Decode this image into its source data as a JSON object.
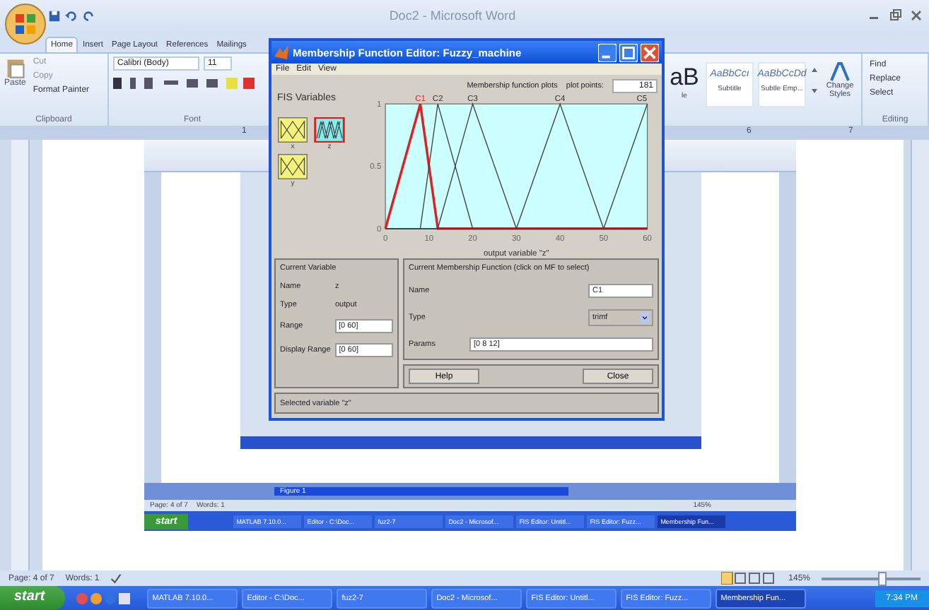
{
  "word": {
    "title": "Doc2 - Microsoft Word",
    "tabs": [
      {
        "label": "Home",
        "selected": true
      },
      {
        "label": "Insert",
        "selected": false
      },
      {
        "label": "Page Layout",
        "selected": false
      },
      {
        "label": "References",
        "selected": false
      },
      {
        "label": "Mailings",
        "selected": false
      }
    ],
    "clipboard": {
      "paste": "Paste",
      "cut": "Cut",
      "copy": "Copy",
      "format_painter": "Format Painter",
      "group": "Clipboard"
    },
    "font": {
      "name": "Calibri (Body)",
      "size": "11",
      "group": "Font"
    },
    "styles": [
      {
        "sample": "aB",
        "label": "le"
      },
      {
        "sample": "AaBbCcı",
        "label": "Subtitle"
      },
      {
        "sample": "AaBbCcDd",
        "label": "Subtle Emp..."
      }
    ],
    "change_styles": "Change Styles",
    "editing": {
      "find": "Find",
      "replace": "Replace",
      "select": "Select",
      "group": "Editing"
    },
    "ruler_marks": [
      "1",
      "6",
      "7"
    ],
    "status": {
      "page": "Page: 4 of 7",
      "words": "Words: 1",
      "zoom": "145%",
      "zoom_slider": {
        "level": 0.62
      }
    }
  },
  "embedded": {
    "figure_title": "Figure 1",
    "status_page": "Page: 4 of 7",
    "status_words": "Words: 1",
    "zoom": "145%",
    "start": "start",
    "taskbar": [
      {
        "label": "MATLAB 7.10.0...",
        "selected": false
      },
      {
        "label": "Editor - C:\\Doc...",
        "selected": false
      },
      {
        "label": "fuz2-7",
        "selected": false
      },
      {
        "label": "Doc2 - Microsof...",
        "selected": false
      },
      {
        "label": "FIS Editor: Untitl...",
        "selected": false
      },
      {
        "label": "FIS Editor: Fuzz...",
        "selected": false
      },
      {
        "label": "Membership Fun...",
        "selected": true
      }
    ]
  },
  "editor": {
    "title": "Membership Function Editor: Fuzzy_machine",
    "menu": [
      "File",
      "Edit",
      "View"
    ],
    "fis_heading": "FIS Variables",
    "variables": [
      {
        "name": "x",
        "kind": "input",
        "selected": false
      },
      {
        "name": "z",
        "kind": "output",
        "selected": true
      },
      {
        "name": "y",
        "kind": "input",
        "selected": false
      }
    ],
    "plots_label": "Membership function plots",
    "plot_points_label": "plot points:",
    "plot_points": "181",
    "chart_data": {
      "type": "line",
      "xlabel": "output variable \"z\"",
      "x": [
        0,
        8,
        12,
        20,
        30,
        40,
        50,
        60
      ],
      "series": [
        {
          "name": "C1",
          "color": "#e02020",
          "values": [
            0,
            1,
            0,
            0,
            0,
            0,
            0,
            0
          ]
        },
        {
          "name": "C2",
          "color": "#404040",
          "values": [
            0,
            0,
            1,
            0,
            0,
            0,
            0,
            0
          ]
        },
        {
          "name": "C3",
          "color": "#404040",
          "values": [
            0,
            0,
            0,
            1,
            0,
            0,
            0,
            0
          ]
        },
        {
          "name": "C4",
          "color": "#404040",
          "values": [
            0,
            0,
            0,
            0,
            0,
            1,
            0,
            0
          ]
        },
        {
          "name": "C5",
          "color": "#404040",
          "values": [
            0,
            0,
            0,
            0,
            0,
            0,
            0,
            1
          ]
        }
      ],
      "xlim": [
        0,
        60
      ],
      "ylim": [
        0,
        1
      ],
      "xticks": [
        0,
        10,
        20,
        30,
        40,
        50,
        60
      ],
      "yticks": [
        0,
        0.5,
        1
      ]
    },
    "current_variable": {
      "heading": "Current Variable",
      "name_label": "Name",
      "name": "z",
      "type_label": "Type",
      "type": "output",
      "range_label": "Range",
      "range": "[0 60]",
      "display_range_label": "Display Range",
      "display_range": "[0 60]"
    },
    "current_mf": {
      "heading": "Current Membership Function (click on MF to select)",
      "name_label": "Name",
      "name": "C1",
      "type_label": "Type",
      "type": "trimf",
      "params_label": "Params",
      "params": "[0 8 12]"
    },
    "buttons": [
      "Help",
      "Close"
    ],
    "status": "Selected variable \"z\""
  },
  "taskbar": {
    "start": "start",
    "items": [
      {
        "label": "MATLAB 7.10.0...",
        "selected": false
      },
      {
        "label": "Editor - C:\\Doc...",
        "selected": false
      },
      {
        "label": "fuz2-7",
        "selected": false
      },
      {
        "label": "Doc2 - Microsof...",
        "selected": false
      },
      {
        "label": "FIS Editor: Untitl...",
        "selected": false
      },
      {
        "label": "FIS Editor: Fuzz...",
        "selected": false
      },
      {
        "label": "Membership Fun...",
        "selected": true
      }
    ],
    "clock": "7:34 PM"
  }
}
